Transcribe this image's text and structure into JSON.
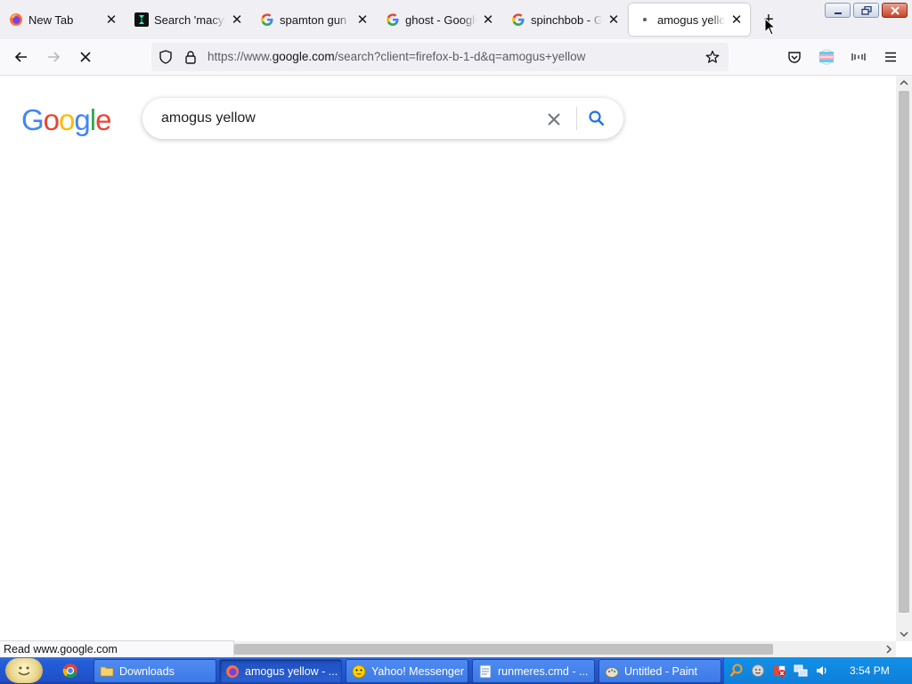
{
  "tabs": [
    {
      "title": "New Tab",
      "icon": "firefox-icon"
    },
    {
      "title": "Search 'macyblack'",
      "icon": "dark-site-icon"
    },
    {
      "title": "spamton gun - Google Search",
      "icon": "google-g-icon"
    },
    {
      "title": "ghost - Google Search",
      "icon": "google-g-icon"
    },
    {
      "title": "spinchbob - Google Search",
      "icon": "google-g-icon"
    },
    {
      "title": "amogus yellow",
      "icon": "loading-dot-icon",
      "active": true
    }
  ],
  "address_bar": {
    "scheme": "https://www.",
    "host": "google.com",
    "path": "/search?client=firefox-b-1-d&q=amogus+yellow"
  },
  "google": {
    "logo_letters": [
      {
        "ch": "G",
        "color": "#4285F4"
      },
      {
        "ch": "o",
        "color": "#EA4335"
      },
      {
        "ch": "o",
        "color": "#FBBC05"
      },
      {
        "ch": "g",
        "color": "#4285F4"
      },
      {
        "ch": "l",
        "color": "#34A853"
      },
      {
        "ch": "e",
        "color": "#EA4335"
      }
    ],
    "query": "amogus yellow"
  },
  "status_text": "Read www.google.com",
  "taskbar": {
    "items": [
      {
        "label": "Downloads",
        "icon": "folder-icon"
      },
      {
        "label": "amogus yellow - ...",
        "icon": "firefox-icon",
        "pressed": true
      },
      {
        "label": "Yahoo! Messenger",
        "icon": "smiley-icon"
      },
      {
        "label": "runmeres.cmd - ...",
        "icon": "notepad-icon"
      },
      {
        "label": "Untitled - Paint",
        "icon": "paint-icon"
      }
    ],
    "clock": "3:54 PM"
  },
  "colors": {
    "accent_blue": "#1a73e8",
    "taskbar_blue": "#245edb",
    "tray_blue": "#0f7fd8"
  }
}
